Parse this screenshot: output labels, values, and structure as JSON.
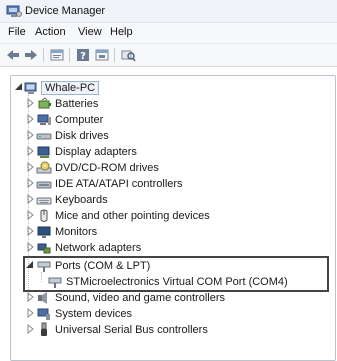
{
  "window": {
    "title": "Device Manager"
  },
  "menu": {
    "items": [
      "File",
      "Action",
      "View",
      "Help"
    ]
  },
  "tree": {
    "root": "Whale-PC",
    "categories": [
      {
        "label": "Batteries",
        "icon": "battery-icon",
        "expanded": false
      },
      {
        "label": "Computer",
        "icon": "computer-icon",
        "expanded": false
      },
      {
        "label": "Disk drives",
        "icon": "disk-drive-icon",
        "expanded": false
      },
      {
        "label": "Display adapters",
        "icon": "display-adapter-icon",
        "expanded": false
      },
      {
        "label": "DVD/CD-ROM drives",
        "icon": "dvd-drive-icon",
        "expanded": false
      },
      {
        "label": "IDE ATA/ATAPI controllers",
        "icon": "ide-controller-icon",
        "expanded": false
      },
      {
        "label": "Keyboards",
        "icon": "keyboard-icon",
        "expanded": false
      },
      {
        "label": "Mice and other pointing devices",
        "icon": "mouse-icon",
        "expanded": false
      },
      {
        "label": "Monitors",
        "icon": "monitor-icon",
        "expanded": false
      },
      {
        "label": "Network adapters",
        "icon": "network-adapter-icon",
        "expanded": false
      },
      {
        "label": "Ports (COM & LPT)",
        "icon": "port-icon",
        "expanded": true,
        "children": [
          {
            "label": "STMicroelectronics Virtual COM Port (COM4)",
            "icon": "port-icon"
          }
        ]
      },
      {
        "label": "Sound, video and game controllers",
        "icon": "sound-icon",
        "expanded": false
      },
      {
        "label": "System devices",
        "icon": "system-device-icon",
        "expanded": false
      },
      {
        "label": "Universal Serial Bus controllers",
        "icon": "usb-icon",
        "expanded": false
      }
    ]
  },
  "colors": {
    "highlight_border": "#444444",
    "panel_border": "#bcc3cc",
    "selection_bg": "#eef3fa"
  }
}
